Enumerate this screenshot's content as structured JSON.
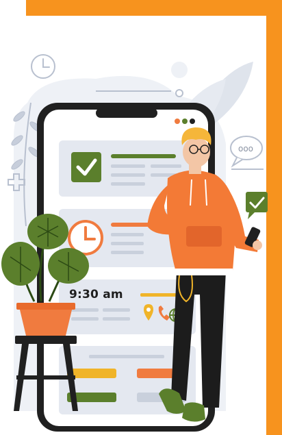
{
  "illustration": {
    "time_label": "9:30 am",
    "chat_bubble_dots": "ooo",
    "palette": {
      "frame_orange": "#f7931e",
      "phone_body": "#202020",
      "screen_bg": "#ffffff",
      "card_bg": "#e4e8f0",
      "accent_green": "#5b7f2c",
      "accent_orange": "#f07b3f",
      "accent_yellow": "#f0b429",
      "hoodie_orange": "#f37a36",
      "hair_yellow": "#f5b63a"
    },
    "icons": [
      "clock-icon",
      "check-icon",
      "chat-bubble-icon",
      "medical-cross-icon",
      "location-pin-icon",
      "phone-call-icon",
      "globe-icon",
      "plant-icon",
      "smartphone-icon"
    ]
  }
}
